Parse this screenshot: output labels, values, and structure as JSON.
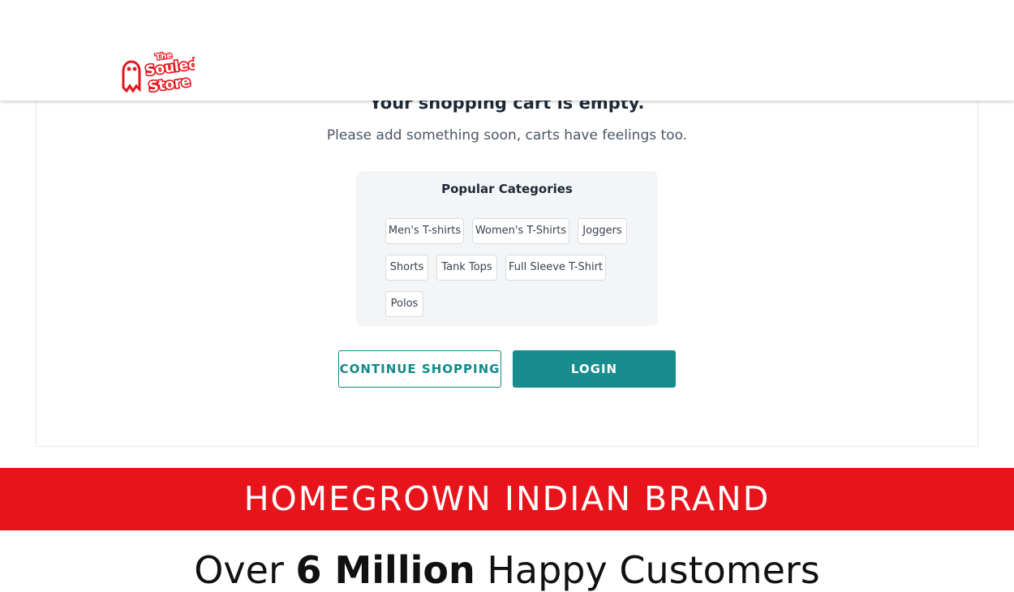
{
  "brand": {
    "logo_line1": "The",
    "logo_line2": "Souled",
    "logo_line3": "Store",
    "accent_color": "#e8141b"
  },
  "cart": {
    "empty_title": "Your shopping cart is empty.",
    "empty_subtitle": "Please add something soon, carts have feelings too."
  },
  "popular": {
    "title": "Popular Categories",
    "categories": [
      "Men's T-shirts",
      "Women's T-Shirts",
      "Joggers",
      "Shorts",
      "Tank Tops",
      "Full Sleeve T-Shirt",
      "Polos"
    ]
  },
  "actions": {
    "continue_label": "CONTINUE SHOPPING",
    "login_label": "LOGIN",
    "primary_color": "#178d8d"
  },
  "banner": {
    "text": "HOMEGROWN INDIAN BRAND"
  },
  "stats": {
    "prefix": "Over ",
    "highlight": "6 Million",
    "suffix": " Happy Customers"
  }
}
